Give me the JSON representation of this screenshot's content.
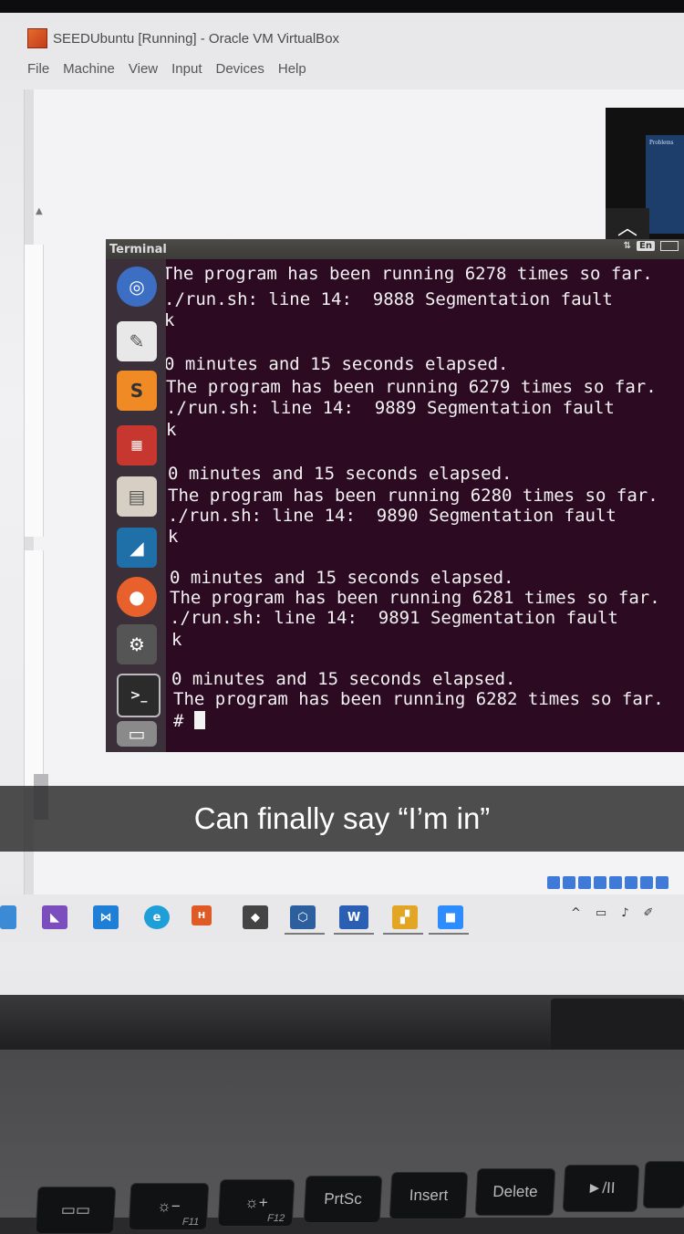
{
  "window": {
    "title": "SEEDUbuntu [Running] - Oracle VM VirtualBox",
    "menu": [
      "File",
      "Machine",
      "View",
      "Input",
      "Devices",
      "Help"
    ]
  },
  "terminal": {
    "title": "Terminal",
    "indicator_lang": "En",
    "lines": [
      "The program has been running 6278 times so far.",
      "./run.sh: line 14:  9888 Segmentation fault",
      "k",
      "",
      "0 minutes and 15 seconds elapsed.",
      "The program has been running 6279 times so far.",
      "./run.sh: line 14:  9889 Segmentation fault",
      "k",
      "",
      "0 minutes and 15 seconds elapsed.",
      "The program has been running 6280 times so far.",
      "./run.sh: line 14:  9890 Segmentation fault",
      "k",
      "",
      "0 minutes and 15 seconds elapsed.",
      "The program has been running 6281 times so far.",
      "./run.sh: line 14:  9891 Segmentation fault",
      "k",
      "",
      "0 minutes and 15 seconds elapsed.",
      "The program has been running 6282 times so far."
    ],
    "prompt": "# "
  },
  "launcher": {
    "icons": [
      "ubuntu-dash-icon",
      "text-editor-icon",
      "sublime-text-icon",
      "workspace-icon",
      "files-icon",
      "wireshark-icon",
      "firefox-icon",
      "settings-icon",
      "terminal-icon",
      "trash-icon"
    ]
  },
  "meeting": {
    "slide_title": "Problems"
  },
  "caption": "Can finally say “I’m in”",
  "keyboard": {
    "keys": [
      {
        "label": "",
        "sub": ""
      },
      {
        "label": "☼−",
        "sub": "F11"
      },
      {
        "label": "☼+",
        "sub": "F12"
      },
      {
        "label": "PrtSc",
        "sub": ""
      },
      {
        "label": "Insert",
        "sub": ""
      },
      {
        "label": "Delete",
        "sub": ""
      },
      {
        "label": "►/II",
        "sub": ""
      }
    ]
  },
  "taskbar": {
    "icons": [
      "visual-studio-icon",
      "vscode-icon",
      "edge-icon",
      "office-icon",
      "git-icon",
      "virtualbox-icon",
      "word-icon",
      "file-manager-icon",
      "zoom-icon"
    ]
  },
  "colors": {
    "terminal_bg": "#2c0a22",
    "launcher_bg": "#3b2f3a",
    "caption_bg": "#28282a"
  }
}
